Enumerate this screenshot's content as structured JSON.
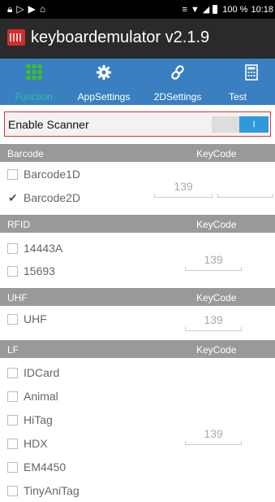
{
  "status_bar": {
    "notification_icons": [
      "lock-icon",
      "play-store-icon",
      "play-icon",
      "robot-icon"
    ],
    "system_icons": [
      "vibrate-icon",
      "wifi-icon",
      "no-signal-icon",
      "battery-icon"
    ],
    "battery": "100 %",
    "time": "10:18"
  },
  "app_bar": {
    "title": "keyboardemulator v2.1.9",
    "icon": "keyboard-icon"
  },
  "tabs": [
    {
      "label": "Function",
      "icon": "grid-icon",
      "active": true
    },
    {
      "label": "AppSettings",
      "icon": "gear-icon"
    },
    {
      "label": "2DSettings",
      "icon": "link-icon"
    },
    {
      "label": "Test",
      "icon": "calculator-icon"
    }
  ],
  "enable_scanner": {
    "label": "Enable Scanner",
    "switch_text": "I",
    "on": true
  },
  "sections": {
    "barcode": {
      "name": "Barcode",
      "keycode_label": "KeyCode",
      "items": [
        {
          "label": "Barcode1D",
          "checked": false
        },
        {
          "label": "Barcode2D",
          "checked": true
        }
      ],
      "keycode_value": "139",
      "extra_value": ""
    },
    "rfid": {
      "name": "RFID",
      "keycode_label": "KeyCode",
      "items": [
        {
          "label": "14443A",
          "checked": false
        },
        {
          "label": "15693",
          "checked": false
        }
      ],
      "keycode_value": "139"
    },
    "uhf": {
      "name": "UHF",
      "keycode_label": "KeyCode",
      "items": [
        {
          "label": "UHF",
          "checked": false
        }
      ],
      "keycode_value": "139"
    },
    "lf": {
      "name": "LF",
      "keycode_label": "KeyCode",
      "items": [
        {
          "label": "IDCard",
          "checked": false
        },
        {
          "label": "Animal",
          "checked": false
        },
        {
          "label": "HiTag",
          "checked": false
        },
        {
          "label": "HDX",
          "checked": false
        },
        {
          "label": "EM4450",
          "checked": false
        },
        {
          "label": "TinyAniTag",
          "checked": false
        }
      ],
      "keycode_value": "139"
    }
  },
  "colors": {
    "tab_bar": "#3a7fbf",
    "active_tab": "#2ec0a0",
    "section_header": "#999999",
    "highlight_border": "#d9342b",
    "switch_on": "#2f9ad9"
  }
}
